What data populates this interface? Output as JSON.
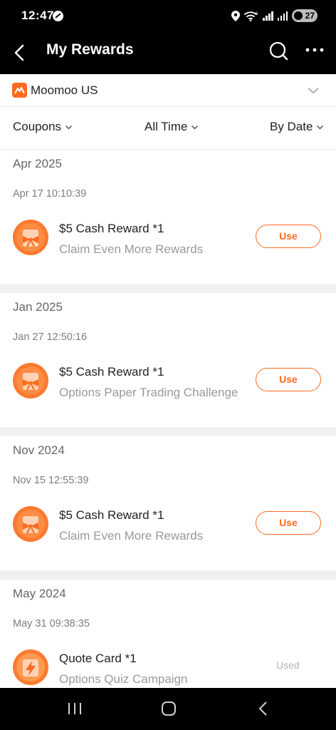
{
  "status_bar": {
    "time": "12:47",
    "battery": "27"
  },
  "header": {
    "title": "My Rewards"
  },
  "account": {
    "name": "Moomoo US"
  },
  "filters": {
    "type": "Coupons",
    "period": "All Time",
    "sort": "By Date"
  },
  "colors": {
    "accent": "#ff6a1f",
    "divider": "#f0f0f0"
  },
  "sections": [
    {
      "month": "Apr 2025",
      "date": "Apr 17 10:10:39",
      "title": "$5 Cash Reward *1",
      "subtitle": "Claim Even More Rewards",
      "action": "Use",
      "icon": "gift-coupon-icon"
    },
    {
      "month": "Jan 2025",
      "date": "Jan 27 12:50:16",
      "title": "$5 Cash Reward *1",
      "subtitle": "Options Paper Trading Challenge",
      "action": "Use",
      "icon": "gift-coupon-icon"
    },
    {
      "month": "Nov 2024",
      "date": "Nov 15 12:55:39",
      "title": "$5 Cash Reward *1",
      "subtitle": "Claim Even More Rewards",
      "action": "Use",
      "icon": "gift-coupon-icon"
    },
    {
      "month": "May 2024",
      "date": "May 31 09:38:35",
      "title": "Quote Card *1",
      "subtitle": "Options Quiz Campaign",
      "action": "Used",
      "icon": "lightning-card-icon"
    }
  ]
}
